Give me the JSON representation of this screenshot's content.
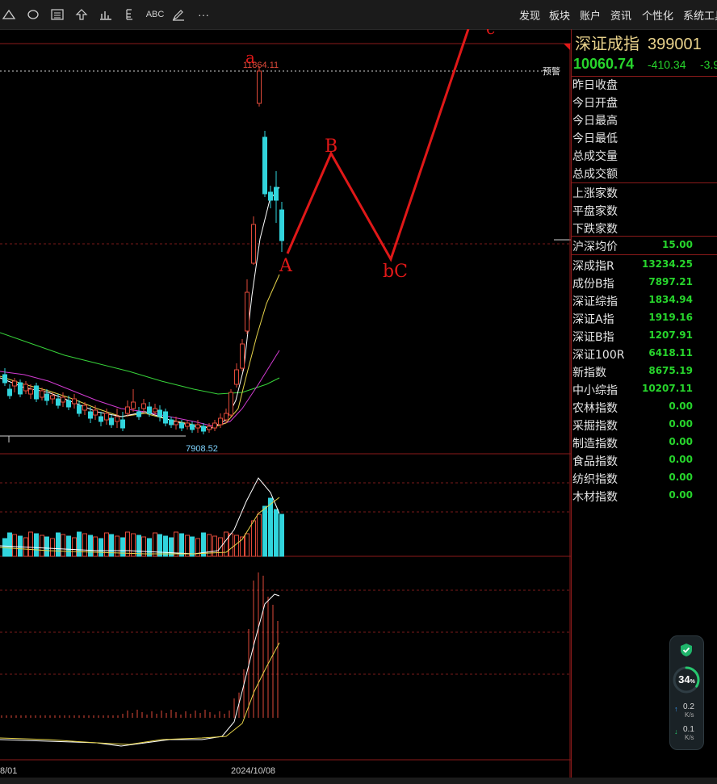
{
  "toolbar": {
    "icons": [
      "triangle-draw-icon",
      "ellipse-draw-icon",
      "rect-list-icon",
      "arrow-up-icon",
      "bar-chart-icon",
      "text-tool-icon",
      "abc-text-icon",
      "pen-tool-icon",
      "more-icon"
    ],
    "abc_label": "ABC",
    "more_label": "···",
    "menu": [
      "发现",
      "板块",
      "账户",
      "资讯",
      "个性化",
      "系统工具"
    ]
  },
  "quote": {
    "name": "深证成指",
    "code": "399001",
    "price": "10060.74",
    "change": "-410.34",
    "change_pct": "-3.9",
    "up_color": "#ff3b3b",
    "down_color": "#27d52c"
  },
  "panel_rows_1": [
    "昨日收盘",
    "今日开盘",
    "今日最高",
    "今日最低",
    "总成交量",
    "总成交额"
  ],
  "panel_rows_2": [
    "上涨家数",
    "平盘家数",
    "下跌家数"
  ],
  "panel_avg": {
    "label": "沪深均价",
    "value": "15.00"
  },
  "panel_indices": [
    {
      "label": "深成指R",
      "value": "13234.25"
    },
    {
      "label": "成份B指",
      "value": "7897.21"
    },
    {
      "label": "深证综指",
      "value": "1834.94"
    },
    {
      "label": "深证A指",
      "value": "1919.16"
    },
    {
      "label": "深证B指",
      "value": "1207.91"
    },
    {
      "label": "深证100R",
      "value": "6418.11"
    },
    {
      "label": "新指数",
      "value": "8675.19"
    },
    {
      "label": "中小综指",
      "value": "10207.11"
    },
    {
      "label": "农林指数",
      "value": "0.00"
    },
    {
      "label": "采掘指数",
      "value": "0.00"
    },
    {
      "label": "制造指数",
      "value": "0.00"
    },
    {
      "label": "食品指数",
      "value": "0.00"
    },
    {
      "label": "纺织指数",
      "value": "0.00"
    },
    {
      "label": "木材指数",
      "value": "0.00"
    }
  ],
  "chart": {
    "high_label": "11864.11",
    "low_label": "7908.52",
    "alert_label": "预警",
    "x_labels": [
      "8/01",
      "2024/10/08"
    ],
    "wave_labels": [
      "a",
      "A",
      "B",
      "bC",
      "c"
    ],
    "wave_color": "#e01818",
    "price_high": 11864.11,
    "price_low": 7908.52
  },
  "chart_data": {
    "type": "candlestick",
    "x": [
      "8/01",
      "2024/10/08"
    ],
    "annotations": [
      "11864.11",
      "7908.52",
      "a",
      "A",
      "B",
      "bC",
      "c"
    ],
    "ylim": [
      7908.52,
      11864.11
    ]
  },
  "widget": {
    "percent": "34",
    "percent_sign": "%",
    "up_speed": "0.2",
    "down_speed": "0.1",
    "unit": "K/s"
  }
}
